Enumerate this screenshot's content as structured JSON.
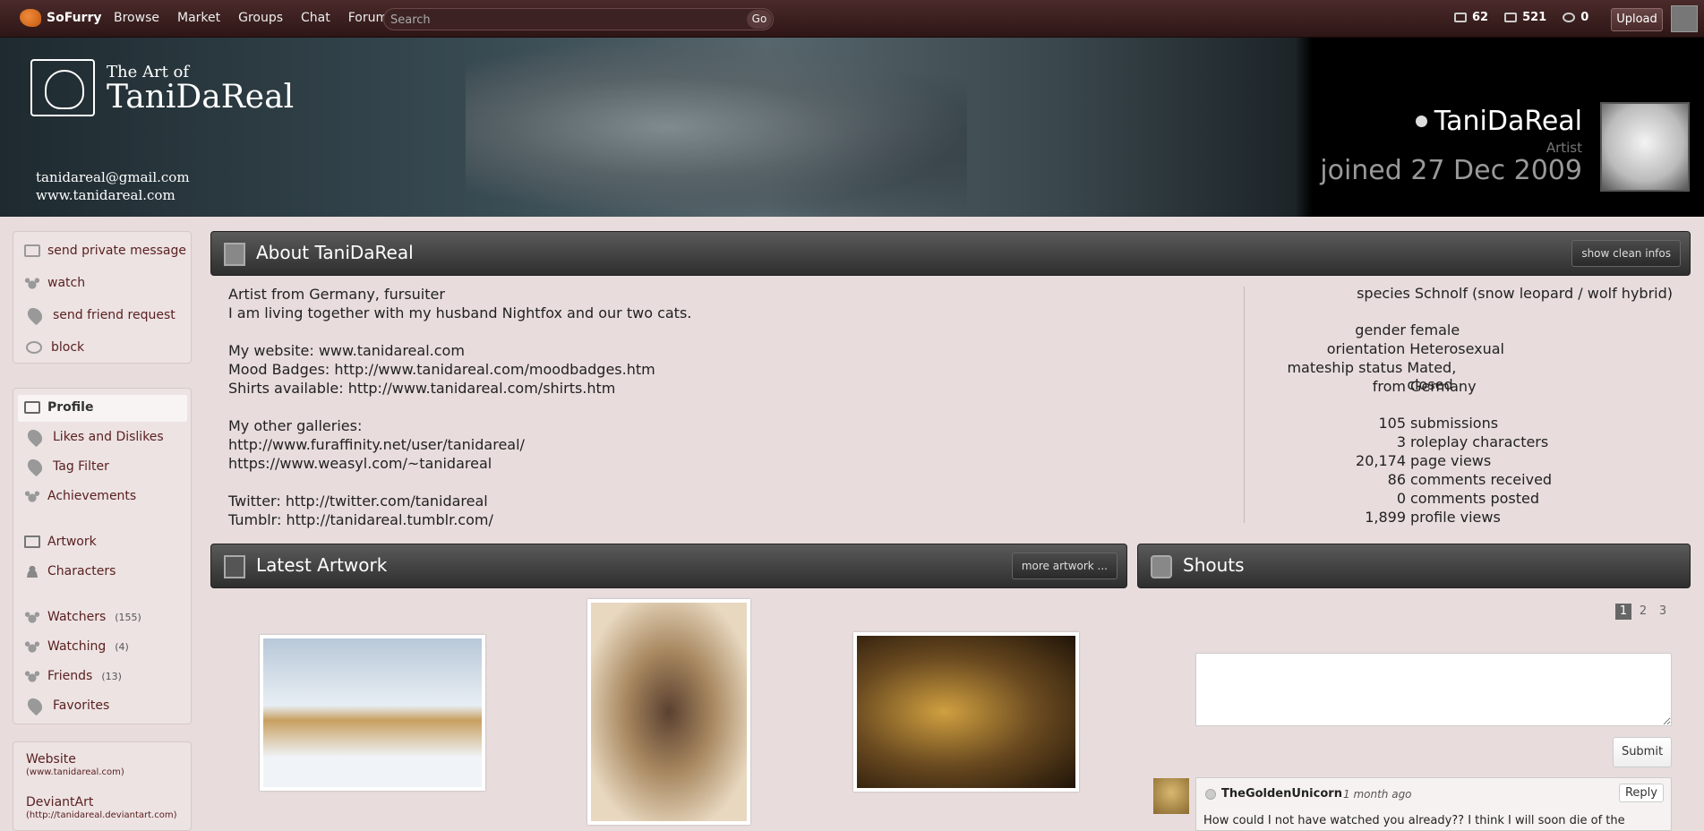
{
  "topbar": {
    "site_name": "SoFurry",
    "nav": [
      "Browse",
      "Market",
      "Groups",
      "Chat",
      "Forum"
    ],
    "search_placeholder": "Search",
    "go_label": "Go",
    "counters": [
      {
        "icon": "submissions-icon",
        "value": "62"
      },
      {
        "icon": "inbox-icon",
        "value": "521"
      },
      {
        "icon": "chat-bubble-icon",
        "value": "0"
      }
    ],
    "upload_label": "Upload"
  },
  "banner": {
    "title_small": "The Art of",
    "title_big": "TaniDaReal",
    "email": "tanidareal@gmail.com",
    "website": "www.tanidareal.com",
    "username": "TaniDaReal",
    "role": "Artist",
    "joined": "joined 27 Dec 2009"
  },
  "sidebar": {
    "actions": [
      {
        "icon": "mail-icon",
        "label": "send private message"
      },
      {
        "icon": "paw-icon",
        "label": "watch"
      },
      {
        "icon": "heart-icon",
        "label": "send friend request"
      },
      {
        "icon": "block-icon",
        "label": "block"
      }
    ],
    "sections": [
      {
        "icon": "pencil-icon",
        "label": "Profile"
      },
      {
        "icon": "heart-icon",
        "label": "Likes and Dislikes"
      },
      {
        "icon": "heart-icon",
        "label": "Tag Filter"
      },
      {
        "icon": "paw-icon",
        "label": "Achievements"
      },
      {
        "icon": "image-icon",
        "label": "Artwork"
      },
      {
        "icon": "person-icon",
        "label": "Characters"
      },
      {
        "icon": "paw-icon",
        "label": "Watchers",
        "count": "(155)"
      },
      {
        "icon": "paw-icon",
        "label": "Watching",
        "count": "(4)"
      },
      {
        "icon": "paw-icon",
        "label": "Friends",
        "count": "(13)"
      },
      {
        "icon": "heart-icon",
        "label": "Favorites"
      }
    ],
    "links": [
      {
        "title": "Website",
        "url": "(www.tanidareal.com)"
      },
      {
        "title": "DeviantArt",
        "url": "(http://tanidareal.deviantart.com)"
      }
    ]
  },
  "about": {
    "title": "About TaniDaReal",
    "clean_btn": "show clean infos",
    "bio": "Artist from Germany, fursuiter\nI am living together with my husband Nightfox and our two cats.\n\nMy website: www.tanidareal.com\nMood Badges: http://www.tanidareal.com/moodbadges.htm\nShirts available: http://www.tanidareal.com/shirts.htm\n\nMy other galleries:\nhttp://www.furaffinity.net/user/tanidareal/\nhttps://www.weasyl.com/~tanidareal\n\nTwitter: http://twitter.com/tanidareal\nTumblr: http://tanidareal.tumblr.com/",
    "info": [
      {
        "k": "species",
        "v": "Schnolf (snow leopard / wolf hybrid)"
      },
      {
        "k": "gender",
        "v": "female"
      },
      {
        "k": "orientation",
        "v": "Heterosexual"
      },
      {
        "k": "mateship status",
        "v": "Mated, closed"
      },
      {
        "k": "from",
        "v": "Germany"
      }
    ],
    "stats": [
      {
        "k": "105",
        "v": "submissions"
      },
      {
        "k": "3",
        "v": "roleplay characters"
      },
      {
        "k": "20,174",
        "v": "page views"
      },
      {
        "k": "86",
        "v": "comments received"
      },
      {
        "k": "0",
        "v": "comments posted"
      },
      {
        "k": "1,899",
        "v": "profile views"
      }
    ]
  },
  "artwork": {
    "title": "Latest Artwork",
    "more_btn": "more artwork ..."
  },
  "shouts": {
    "title": "Shouts",
    "pages": [
      "1",
      "2",
      "3"
    ],
    "submit_label": "Submit",
    "comment": {
      "author": "TheGoldenUnicorn",
      "time": "1 month ago",
      "reply": "Reply",
      "text": "How could I not have watched you already?? I think I will soon die of the"
    }
  }
}
